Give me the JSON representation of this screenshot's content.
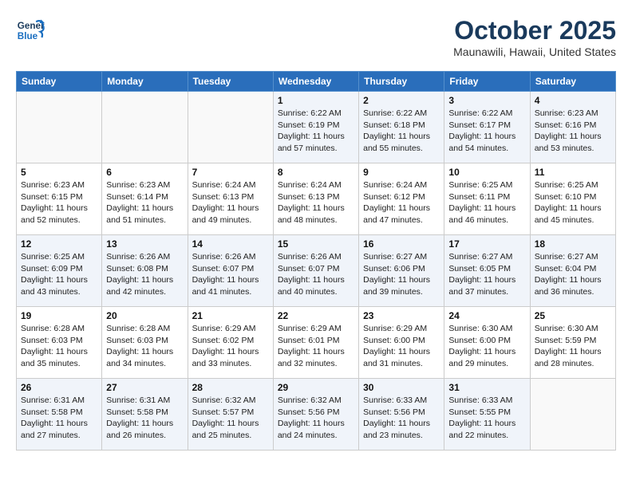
{
  "header": {
    "logo_line1": "General",
    "logo_line2": "Blue",
    "month": "October 2025",
    "location": "Maunawili, Hawaii, United States"
  },
  "weekdays": [
    "Sunday",
    "Monday",
    "Tuesday",
    "Wednesday",
    "Thursday",
    "Friday",
    "Saturday"
  ],
  "weeks": [
    [
      {
        "day": "",
        "info": ""
      },
      {
        "day": "",
        "info": ""
      },
      {
        "day": "",
        "info": ""
      },
      {
        "day": "1",
        "info": "Sunrise: 6:22 AM\nSunset: 6:19 PM\nDaylight: 11 hours and 57 minutes."
      },
      {
        "day": "2",
        "info": "Sunrise: 6:22 AM\nSunset: 6:18 PM\nDaylight: 11 hours and 55 minutes."
      },
      {
        "day": "3",
        "info": "Sunrise: 6:22 AM\nSunset: 6:17 PM\nDaylight: 11 hours and 54 minutes."
      },
      {
        "day": "4",
        "info": "Sunrise: 6:23 AM\nSunset: 6:16 PM\nDaylight: 11 hours and 53 minutes."
      }
    ],
    [
      {
        "day": "5",
        "info": "Sunrise: 6:23 AM\nSunset: 6:15 PM\nDaylight: 11 hours and 52 minutes."
      },
      {
        "day": "6",
        "info": "Sunrise: 6:23 AM\nSunset: 6:14 PM\nDaylight: 11 hours and 51 minutes."
      },
      {
        "day": "7",
        "info": "Sunrise: 6:24 AM\nSunset: 6:13 PM\nDaylight: 11 hours and 49 minutes."
      },
      {
        "day": "8",
        "info": "Sunrise: 6:24 AM\nSunset: 6:13 PM\nDaylight: 11 hours and 48 minutes."
      },
      {
        "day": "9",
        "info": "Sunrise: 6:24 AM\nSunset: 6:12 PM\nDaylight: 11 hours and 47 minutes."
      },
      {
        "day": "10",
        "info": "Sunrise: 6:25 AM\nSunset: 6:11 PM\nDaylight: 11 hours and 46 minutes."
      },
      {
        "day": "11",
        "info": "Sunrise: 6:25 AM\nSunset: 6:10 PM\nDaylight: 11 hours and 45 minutes."
      }
    ],
    [
      {
        "day": "12",
        "info": "Sunrise: 6:25 AM\nSunset: 6:09 PM\nDaylight: 11 hours and 43 minutes."
      },
      {
        "day": "13",
        "info": "Sunrise: 6:26 AM\nSunset: 6:08 PM\nDaylight: 11 hours and 42 minutes."
      },
      {
        "day": "14",
        "info": "Sunrise: 6:26 AM\nSunset: 6:07 PM\nDaylight: 11 hours and 41 minutes."
      },
      {
        "day": "15",
        "info": "Sunrise: 6:26 AM\nSunset: 6:07 PM\nDaylight: 11 hours and 40 minutes."
      },
      {
        "day": "16",
        "info": "Sunrise: 6:27 AM\nSunset: 6:06 PM\nDaylight: 11 hours and 39 minutes."
      },
      {
        "day": "17",
        "info": "Sunrise: 6:27 AM\nSunset: 6:05 PM\nDaylight: 11 hours and 37 minutes."
      },
      {
        "day": "18",
        "info": "Sunrise: 6:27 AM\nSunset: 6:04 PM\nDaylight: 11 hours and 36 minutes."
      }
    ],
    [
      {
        "day": "19",
        "info": "Sunrise: 6:28 AM\nSunset: 6:03 PM\nDaylight: 11 hours and 35 minutes."
      },
      {
        "day": "20",
        "info": "Sunrise: 6:28 AM\nSunset: 6:03 PM\nDaylight: 11 hours and 34 minutes."
      },
      {
        "day": "21",
        "info": "Sunrise: 6:29 AM\nSunset: 6:02 PM\nDaylight: 11 hours and 33 minutes."
      },
      {
        "day": "22",
        "info": "Sunrise: 6:29 AM\nSunset: 6:01 PM\nDaylight: 11 hours and 32 minutes."
      },
      {
        "day": "23",
        "info": "Sunrise: 6:29 AM\nSunset: 6:00 PM\nDaylight: 11 hours and 31 minutes."
      },
      {
        "day": "24",
        "info": "Sunrise: 6:30 AM\nSunset: 6:00 PM\nDaylight: 11 hours and 29 minutes."
      },
      {
        "day": "25",
        "info": "Sunrise: 6:30 AM\nSunset: 5:59 PM\nDaylight: 11 hours and 28 minutes."
      }
    ],
    [
      {
        "day": "26",
        "info": "Sunrise: 6:31 AM\nSunset: 5:58 PM\nDaylight: 11 hours and 27 minutes."
      },
      {
        "day": "27",
        "info": "Sunrise: 6:31 AM\nSunset: 5:58 PM\nDaylight: 11 hours and 26 minutes."
      },
      {
        "day": "28",
        "info": "Sunrise: 6:32 AM\nSunset: 5:57 PM\nDaylight: 11 hours and 25 minutes."
      },
      {
        "day": "29",
        "info": "Sunrise: 6:32 AM\nSunset: 5:56 PM\nDaylight: 11 hours and 24 minutes."
      },
      {
        "day": "30",
        "info": "Sunrise: 6:33 AM\nSunset: 5:56 PM\nDaylight: 11 hours and 23 minutes."
      },
      {
        "day": "31",
        "info": "Sunrise: 6:33 AM\nSunset: 5:55 PM\nDaylight: 11 hours and 22 minutes."
      },
      {
        "day": "",
        "info": ""
      }
    ]
  ]
}
